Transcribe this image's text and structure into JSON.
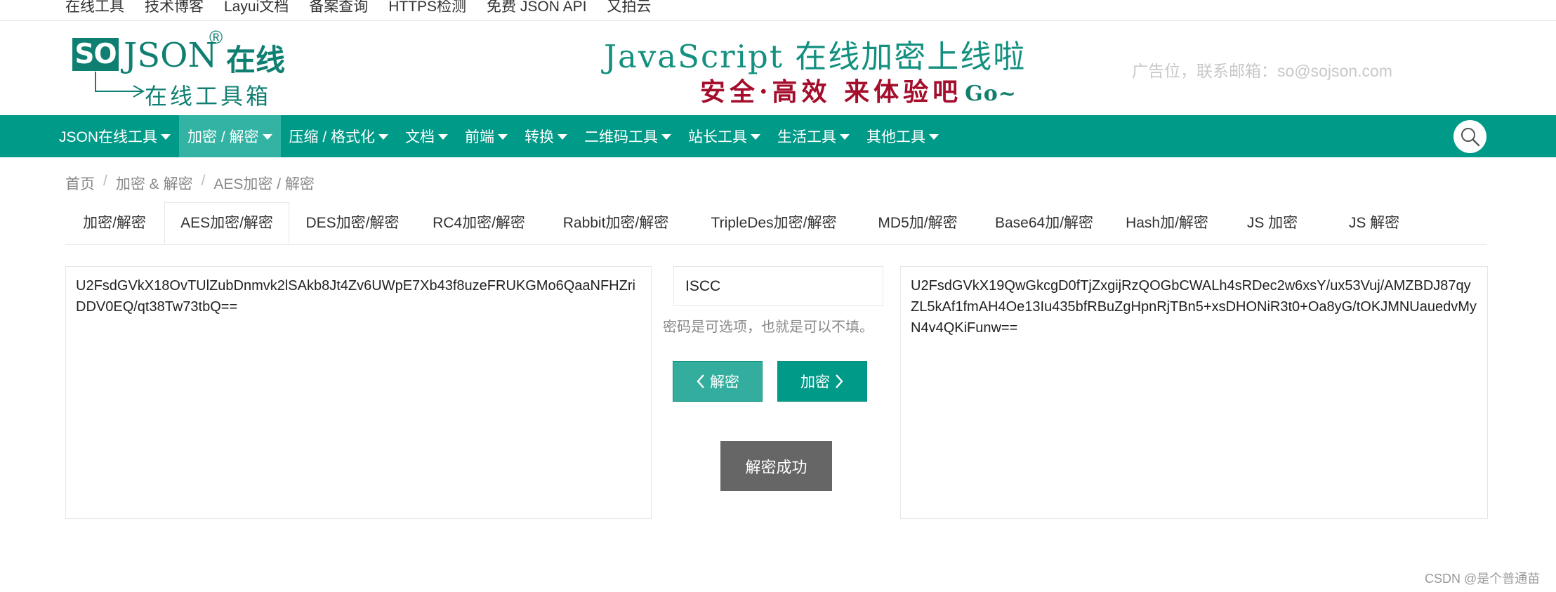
{
  "top_links": [
    "在线工具",
    "技术博客",
    "Layui文档",
    "备案查询",
    "HTTPS检测",
    "免费 JSON API",
    "又拍云"
  ],
  "logo": {
    "so": "SO",
    "json": "JSON",
    "reg": "®",
    "zaixian": "在线",
    "tagline": "在线工具箱"
  },
  "banner": {
    "line1": "JavaScript 在线加密上线啦",
    "line2": "安全·高效 来体验吧",
    "go": "Go~"
  },
  "ad_text": "广告位，联系邮箱：so@sojson.com",
  "nav": {
    "items": [
      {
        "label": "JSON在线工具"
      },
      {
        "label": "加密 / 解密"
      },
      {
        "label": "压缩 / 格式化"
      },
      {
        "label": "文档"
      },
      {
        "label": "前端"
      },
      {
        "label": "转换"
      },
      {
        "label": "二维码工具"
      },
      {
        "label": "站长工具"
      },
      {
        "label": "生活工具"
      },
      {
        "label": "其他工具"
      }
    ],
    "active_index": 1,
    "search_icon": "search-icon"
  },
  "breadcrumb": [
    "首页",
    "加密 & 解密",
    "AES加密 / 解密"
  ],
  "breadcrumb_sep": "/",
  "tabs": [
    "加密/解密",
    "AES加密/解密",
    "DES加密/解密",
    "RC4加密/解密",
    "Rabbit加密/解密",
    "TripleDes加密/解密",
    "MD5加/解密",
    "Base64加/解密",
    "Hash加/解密",
    "JS 加密",
    "JS 解密"
  ],
  "active_tab_index": 1,
  "input_text": "U2FsdGVkX18OvTUlZubDnmvk2lSAkb8Jt4Zv6UWpE7Xb43f8uzeFRUKGMo6QaaNFHZriDDV0EQ/qt38Tw73tbQ==",
  "output_text": "U2FsdGVkX19QwGkcgD0fTjZxgijRzQOGbCWALh4sRDec2w6xsY/ux53Vuj/AMZBDJ87qyZL5kAf1fmAH4Oe13Iu435bfRBuZgHpnRjTBn5+xsDHONiR3t0+Oa8yG/tOKJMNUauedvMyN4v4QKiFunw==",
  "password": {
    "value": "ISCC",
    "hint": "密码是可选项，也就是可以不填。"
  },
  "buttons": {
    "decrypt": "解密",
    "encrypt": "加密"
  },
  "status_text": "解密成功",
  "watermark": "CSDN @是个普通苗",
  "colors": {
    "nav_bg": "#009a88",
    "nav_active": "#33b3a3",
    "brand_green": "#0f7f72",
    "banner_red": "#a40e2c",
    "status_bg": "#666666"
  }
}
